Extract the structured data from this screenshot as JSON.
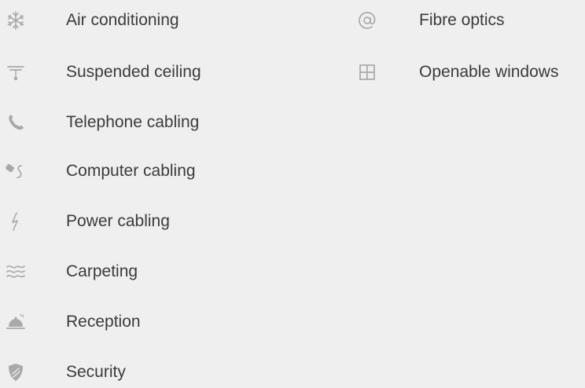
{
  "amenities": {
    "left": [
      {
        "label": "Air conditioning",
        "icon": "snowflake-icon"
      },
      {
        "label": "Suspended ceiling",
        "icon": "ceiling-lamp-icon"
      },
      {
        "label": "Telephone cabling",
        "icon": "phone-icon"
      },
      {
        "label": "Computer cabling",
        "icon": "network-plug-icon"
      },
      {
        "label": "Power cabling",
        "icon": "lightning-icon"
      },
      {
        "label": "Carpeting",
        "icon": "carpet-waves-icon"
      },
      {
        "label": "Reception",
        "icon": "reception-bell-icon"
      },
      {
        "label": "Security",
        "icon": "shield-icon"
      }
    ],
    "right": [
      {
        "label": "Fibre optics",
        "icon": "at-sign-icon"
      },
      {
        "label": "Openable windows",
        "icon": "window-icon"
      }
    ]
  },
  "colors": {
    "background": "#efefef",
    "text": "#3b3b3b",
    "icon": "#a9a9a9"
  }
}
